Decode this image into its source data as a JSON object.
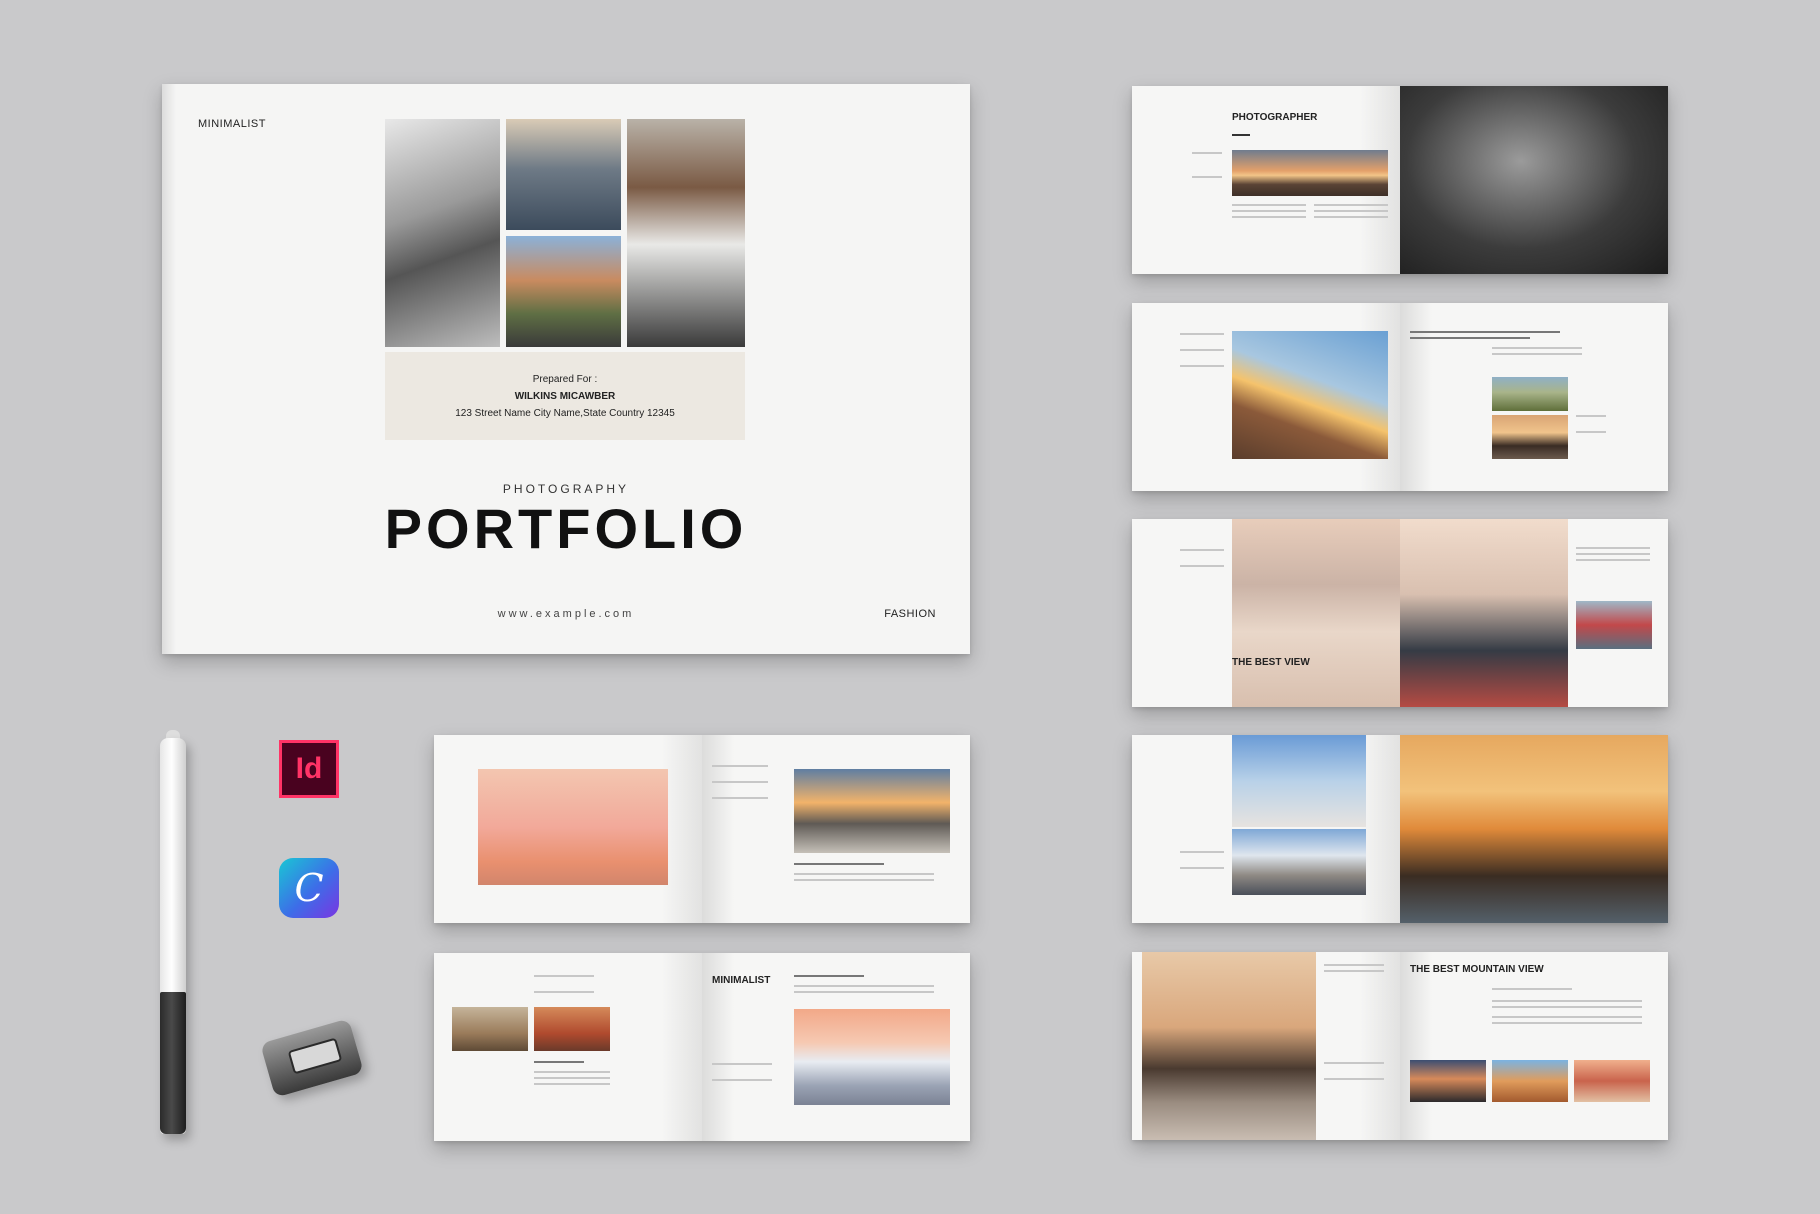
{
  "cover": {
    "brand": "MINIMALIST",
    "prepared_label": "Prepared For :",
    "client_name": "WILKINS MICAWBER",
    "client_address": "123 Street Name City Name,State Country 12345",
    "subtitle": "PHOTOGRAPHY",
    "title": "PORTFOLIO",
    "url": "www.example.com",
    "category": "FASHION"
  },
  "spreads": {
    "photographer_title": "PHOTOGRAPHER",
    "best_view": "THE BEST VIEW",
    "minimalist": "MINIMALIST",
    "best_mountain_view": "THE BEST MOUNTAIN VIEW"
  },
  "apps": {
    "indesign": "Id",
    "canva": "C"
  },
  "colors": {
    "background": "#c9c9cb",
    "indesign_bg": "#49021f",
    "indesign_accent": "#ff3366"
  }
}
